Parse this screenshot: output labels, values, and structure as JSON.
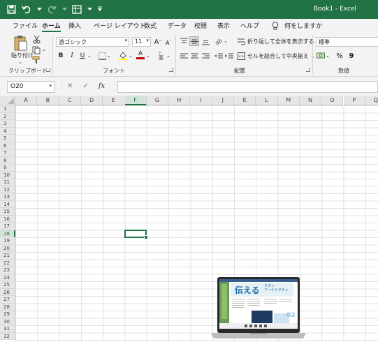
{
  "title": {
    "text": "Book1  -  Excel"
  },
  "qat": {
    "save_icon": "save-icon",
    "undo_icon": "undo-icon",
    "redo_icon": "redo-icon",
    "form_icon": "form-icon",
    "customize_icon": "customize-icon"
  },
  "menu": {
    "tabs": [
      "ファイル",
      "ホーム",
      "挿入",
      "ページ レイアウト",
      "数式",
      "データ",
      "校閲",
      "表示",
      "ヘルプ"
    ],
    "tell_me": "何をしますか"
  },
  "ribbon": {
    "clipboard": {
      "label": "クリップボード",
      "paste": "貼り付け"
    },
    "font": {
      "label": "フォント",
      "font_name": "游ゴシック",
      "font_size": "11",
      "grow": "A",
      "shrink": "A",
      "bold": "B",
      "italic": "I",
      "underline": "U",
      "font_color_letter": "A"
    },
    "alignment": {
      "label": "配置",
      "wrap_text": "折り返して全体を表示する",
      "merge_center": "セルを結合して中央揃え"
    },
    "number": {
      "label": "数値",
      "format": "標準",
      "percent": "%",
      "comma": "9"
    }
  },
  "formula_bar": {
    "name_box": "O20",
    "cancel": "✕",
    "enter": "✓",
    "fx": "fx",
    "value": ""
  },
  "grid": {
    "columns": [
      "A",
      "B",
      "C",
      "D",
      "E",
      "F",
      "G",
      "H",
      "I",
      "J",
      "K",
      "L",
      "M",
      "N",
      "O",
      "P",
      "Q"
    ],
    "rows": [
      "1",
      "2",
      "3",
      "4",
      "5",
      "6",
      "7",
      "8",
      "9",
      "10",
      "11",
      "12",
      "13",
      "14",
      "15",
      "16",
      "17",
      "18",
      "19",
      "20",
      "21",
      "22",
      "23",
      "24",
      "25",
      "26",
      "27",
      "28",
      "29",
      "30",
      "31",
      "32"
    ],
    "active_column": "F",
    "active_row": "18"
  },
  "laptop": {
    "headline": "伝える",
    "subtitle": "モダン\nアーキテクチャ",
    "page_number": "02"
  },
  "colors": {
    "brand": "#217346",
    "ribbon_bg": "#f3f3f3",
    "font_color": "#c00000",
    "fill_color": "#ffff00"
  }
}
